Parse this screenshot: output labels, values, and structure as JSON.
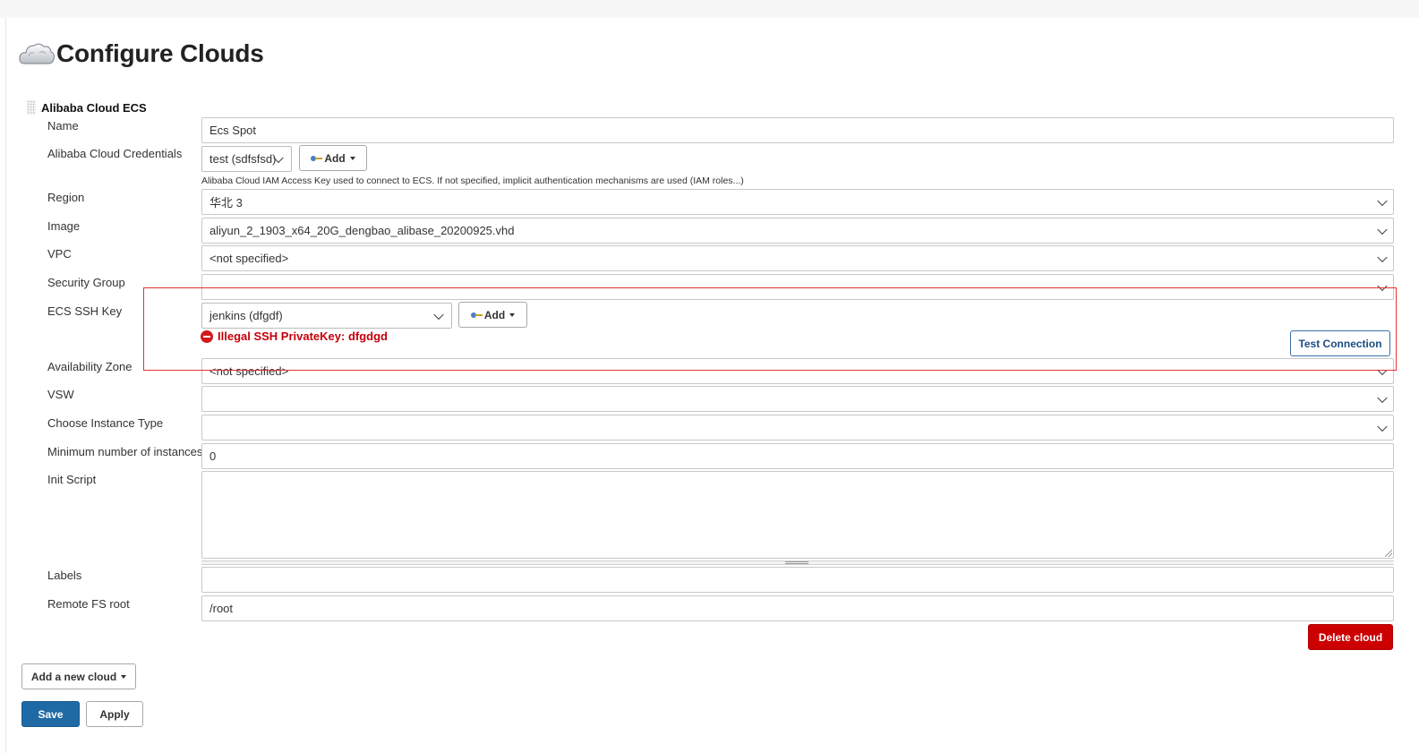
{
  "page": {
    "title": "Configure Clouds",
    "icon": "cloud-icon"
  },
  "cloud": {
    "section_title": "Alibaba Cloud ECS",
    "labels": {
      "name": "Name",
      "credentials": "Alibaba Cloud Credentials",
      "region": "Region",
      "image": "Image",
      "vpc": "VPC",
      "security_group": "Security Group",
      "ssh_key": "ECS SSH Key",
      "availability_zone": "Availability Zone",
      "vsw": "VSW",
      "instance_type": "Choose Instance Type",
      "min_instances": "Minimum number of instances",
      "init_script": "Init Script",
      "labels": "Labels",
      "remote_fs_root": "Remote FS root"
    },
    "values": {
      "name": "Ecs Spot",
      "credentials": "test (sdfsfsd)",
      "region": "华北 3",
      "image": "aliyun_2_1903_x64_20G_dengbao_alibase_20200925.vhd",
      "vpc": "<not specified>",
      "security_group": "",
      "ssh_key": "jenkins (dfgdf)",
      "availability_zone": "<not specified>",
      "vsw": "",
      "instance_type": "",
      "min_instances": "0",
      "init_script": "",
      "labels": "",
      "remote_fs_root": "/root"
    },
    "credentials_help": "Alibaba Cloud IAM Access Key used to connect to ECS. If not specified, implicit authentication mechanisms are used (IAM roles...)",
    "ssh_key_error": "Illegal SSH PrivateKey: dfgdgd",
    "buttons": {
      "add_credentials": "Add",
      "add_ssh_key": "Add",
      "test_connection": "Test Connection",
      "delete_cloud": "Delete cloud"
    }
  },
  "footer": {
    "add_new_cloud": "Add a new cloud",
    "save": "Save",
    "apply": "Apply"
  },
  "colors": {
    "primary": "#1f6aa5",
    "danger": "#cc0000",
    "error_text": "#c4000a",
    "highlight_box": "#e43131"
  }
}
